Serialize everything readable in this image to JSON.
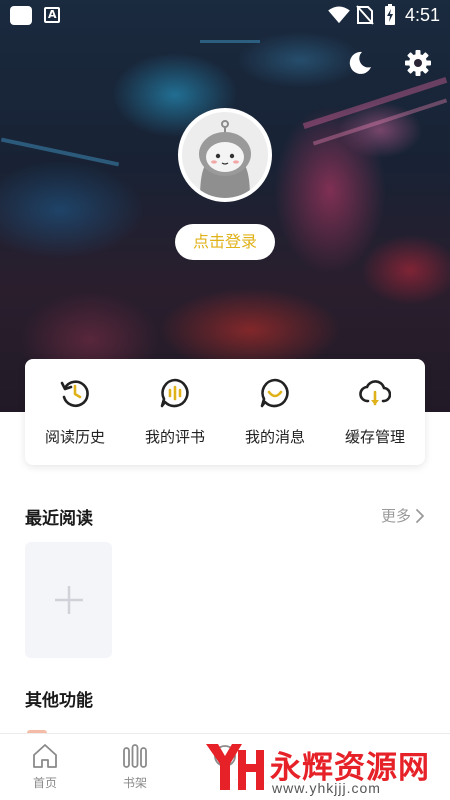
{
  "colors": {
    "accent": "#e0b21a",
    "watermark": "#e62128",
    "text_primary": "#222222",
    "text_muted": "#9a9a9a"
  },
  "status_bar": {
    "time": "4:51",
    "badge_letter": "A",
    "icons": [
      "wifi-icon",
      "no-sim-icon",
      "battery-charging-icon"
    ]
  },
  "header": {
    "night_mode_icon": "moon-icon",
    "settings_icon": "gear-icon",
    "avatar_icon": "robot-avatar",
    "login_label": "点击登录"
  },
  "shortcuts": [
    {
      "label": "阅读历史",
      "icon": "history-icon"
    },
    {
      "label": "我的评书",
      "icon": "audio-book-icon"
    },
    {
      "label": "我的消息",
      "icon": "message-smile-icon"
    },
    {
      "label": "缓存管理",
      "icon": "cloud-download-icon"
    }
  ],
  "recent": {
    "title": "最近阅读",
    "more_label": "更多",
    "add_icon": "plus-icon"
  },
  "other": {
    "title": "其他功能"
  },
  "bottom_nav": [
    {
      "label": "首页",
      "icon": "home-icon"
    },
    {
      "label": "书架",
      "icon": "bookshelf-icon"
    },
    {
      "label": "",
      "icon": "discover-icon"
    },
    {
      "label": "",
      "icon": "category-icon"
    },
    {
      "label": "",
      "icon": "mine-icon"
    }
  ],
  "watermark": {
    "logo_text": "YH",
    "text": "永辉资源网",
    "url": "www.yhkjjj.com"
  }
}
